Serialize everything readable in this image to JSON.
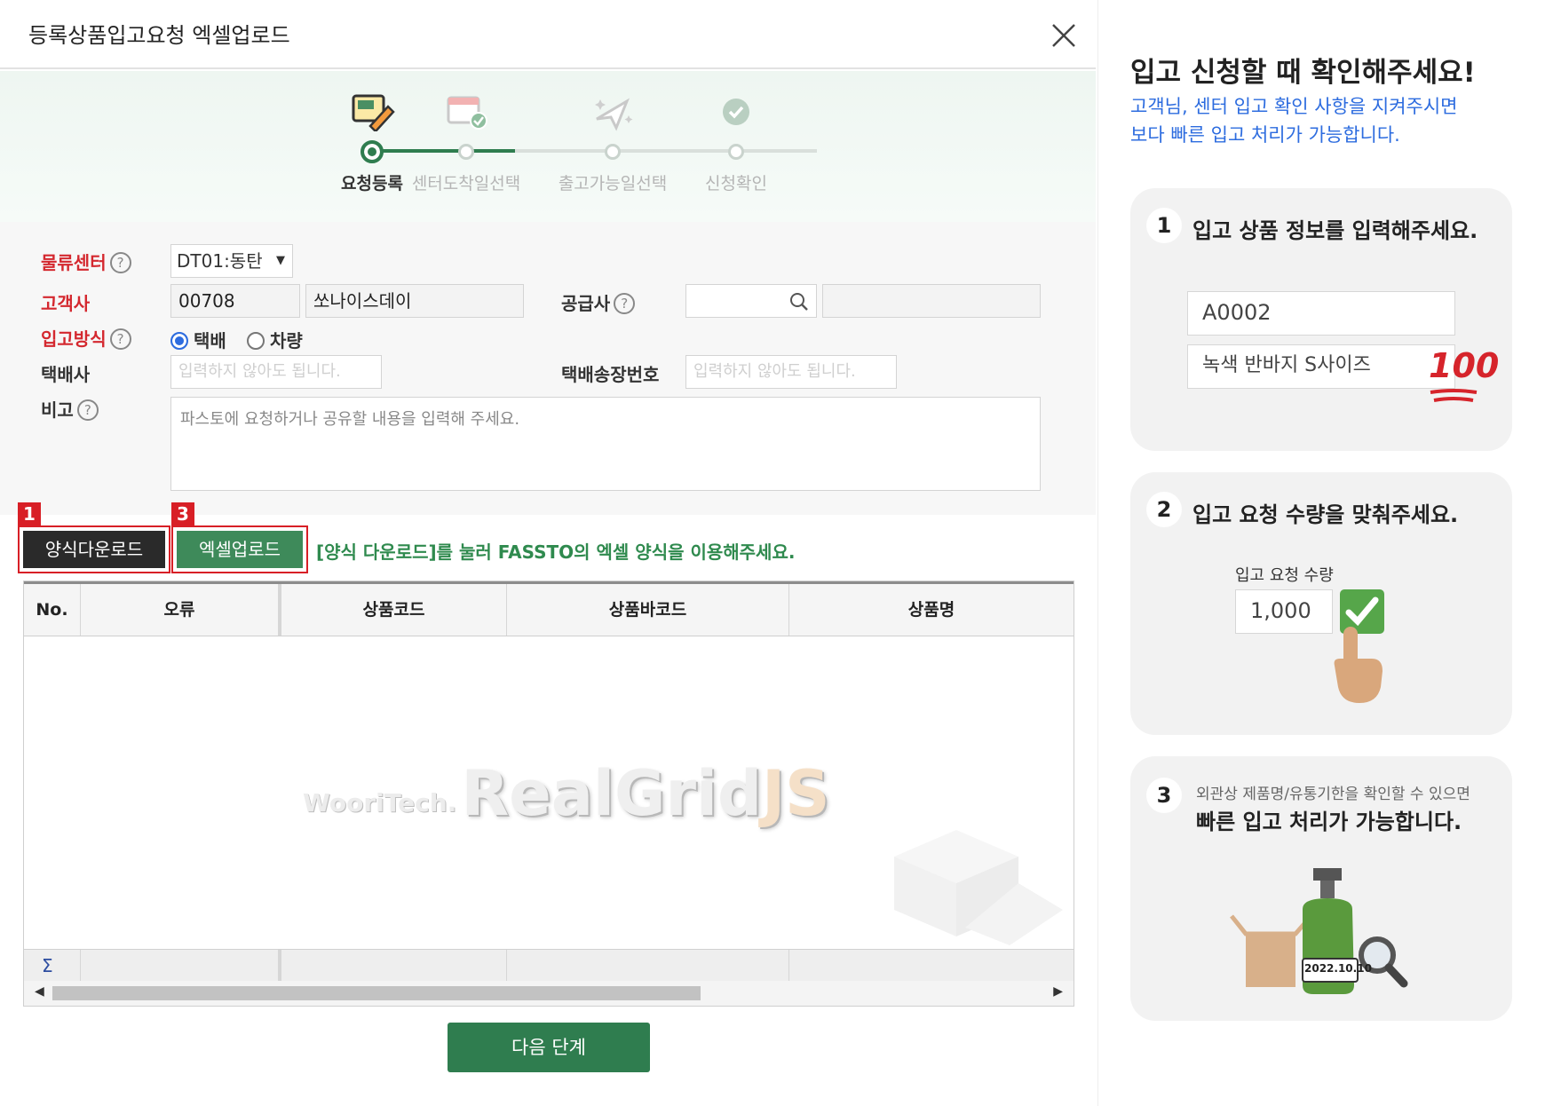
{
  "modal": {
    "title": "등록상품입고요청 엑셀업로드",
    "steps": [
      {
        "label": "요청등록",
        "active": true
      },
      {
        "label": "센터도착일선택",
        "active": false
      },
      {
        "label": "출고가능일선택",
        "active": false
      },
      {
        "label": "신청확인",
        "active": false
      }
    ]
  },
  "form": {
    "center_label": "물류센터",
    "center_value": "DT01:동탄",
    "customer_label": "고객사",
    "customer_code": "00708",
    "customer_name": "쏘나이스데이",
    "supplier_label": "공급사",
    "method_label": "입고방식",
    "method_options": [
      "택배",
      "차량"
    ],
    "method_selected": "택배",
    "courier_label": "택배사",
    "courier_placeholder": "입력하지 않아도 됩니다.",
    "invoice_label": "택배송장번호",
    "invoice_placeholder": "입력하지 않아도 됩니다.",
    "note_label": "비고",
    "note_placeholder": "파스토에 요청하거나 공유할 내용을 입력해 주세요.",
    "help_glyph": "?"
  },
  "actions": {
    "badge1": "1",
    "badge3": "3",
    "download_label": "양식다운로드",
    "upload_label": "엑셀업로드",
    "hint": "[양식 다운로드]를 눌러 FASSTO의 엑셀 양식을 이용해주세요.",
    "next_label": "다음 단계"
  },
  "grid": {
    "columns": [
      "No.",
      "오류",
      "상품코드",
      "상품바코드",
      "상품명"
    ],
    "sigma": "Σ",
    "watermark_small": "WooriTech.",
    "watermark_big": "RealGrid",
    "watermark_js": "JS"
  },
  "guide": {
    "title": "입고 신청할 때 확인해주세요!",
    "subtitle_line1": "고객님, 센터 입고 확인 사항을 지켜주시면",
    "subtitle_line2": "보다 빠른 입고 처리가 가능합니다.",
    "cards": [
      {
        "num": "1",
        "text": "입고 상품 정보를 입력해주세요.",
        "field1": "A0002",
        "field2": "녹색 반바지 S사이즈",
        "stamp": "100"
      },
      {
        "num": "2",
        "text": "입고 요청 수량을 맞춰주세요.",
        "qty_label": "입고 요청 수량",
        "qty_value": "1,000"
      },
      {
        "num": "3",
        "text_small": "외관상 제품명/유통기한을 확인할 수 있으면",
        "text": "빠른 입고 처리가 가능합니다.",
        "date_tag": "2022.10.10"
      }
    ]
  },
  "colors": {
    "brand_green": "#2f7d4f",
    "required_red": "#d4282f",
    "hint_green": "#2f8a4e",
    "link_blue": "#2d6cdf",
    "badge_red": "#d81f26"
  },
  "icons": [
    "close-icon",
    "edit-form-icon",
    "calendar-check-icon",
    "plane-icon",
    "check-circle-icon",
    "help-icon",
    "search-icon",
    "sigma-icon",
    "scroll-left-icon",
    "scroll-right-icon",
    "checkbox-checked-icon",
    "hand-pointer-icon",
    "magnifier-icon",
    "box-icon"
  ]
}
